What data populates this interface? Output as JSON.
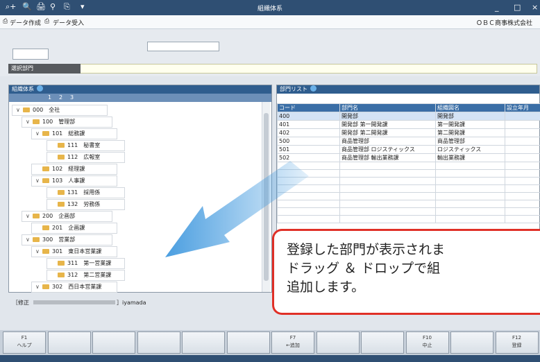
{
  "window": {
    "title": "組織体系"
  },
  "titlebar": {
    "icons": [
      "⌕+",
      "🔍",
      "🖨",
      "⚲",
      "⎘",
      "▾"
    ],
    "controls": [
      "_",
      "□",
      "×"
    ]
  },
  "menubar": {
    "create": "データ作成",
    "import": "データ受入",
    "company": "ＯＢＣ商事株式会社"
  },
  "selection": {
    "label": "選択部門"
  },
  "tree": {
    "title": "組織体系",
    "levels": [
      "1",
      "2",
      "3"
    ],
    "rows": [
      {
        "text": "000　全社",
        "chev": "∨"
      },
      {
        "text": "100　管理部",
        "chev": "∨"
      },
      {
        "text": "101　総務課",
        "chev": "∨"
      },
      {
        "text": "111　秘書室",
        "chev": ""
      },
      {
        "text": "112　広報室",
        "chev": ""
      },
      {
        "text": "102　経理課",
        "chev": ""
      },
      {
        "text": "103　人事課",
        "chev": "∨"
      },
      {
        "text": "131　採用係",
        "chev": ""
      },
      {
        "text": "132　労務係",
        "chev": ""
      },
      {
        "text": "200　企画部",
        "chev": "∨"
      },
      {
        "text": "201　企画課",
        "chev": ""
      },
      {
        "text": "300　営業部",
        "chev": "∨"
      },
      {
        "text": "301　東日本営業課",
        "chev": "∨"
      },
      {
        "text": "311　第一営業課",
        "chev": ""
      },
      {
        "text": "312　第二営業課",
        "chev": ""
      },
      {
        "text": "302　西日本営業課",
        "chev": "∨"
      }
    ]
  },
  "list": {
    "title": "部門リスト",
    "headers": [
      "コード",
      "部門名",
      "組織図名",
      "設立年月"
    ],
    "rows": [
      [
        "400",
        "開発部",
        "開発部",
        ""
      ],
      [
        "401",
        "開発部 第一開発課",
        "第一開発課",
        ""
      ],
      [
        "402",
        "開発部 第二開発課",
        "第二開発課",
        ""
      ],
      [
        "500",
        "商品管理部",
        "商品管理部",
        ""
      ],
      [
        "501",
        "商品管理部 ロジスティックス",
        "ロジスティックス",
        ""
      ],
      [
        "502",
        "商品管理部 輸出業務課",
        "輸出業務課",
        ""
      ]
    ]
  },
  "status": {
    "label": "［修正",
    "user": "］iyamada"
  },
  "fkeys": [
    {
      "num": "F1",
      "label": "ヘルプ"
    },
    {
      "num": "",
      "label": ""
    },
    {
      "num": "",
      "label": ""
    },
    {
      "num": "",
      "label": ""
    },
    {
      "num": "",
      "label": ""
    },
    {
      "num": "",
      "label": ""
    },
    {
      "num": "F7",
      "label": "←追加"
    },
    {
      "num": "",
      "label": ""
    },
    {
      "num": "",
      "label": ""
    },
    {
      "num": "F10",
      "label": "中止"
    },
    {
      "num": "",
      "label": ""
    },
    {
      "num": "F12",
      "label": "登録"
    }
  ],
  "callout": {
    "line1": "登録した部門が表示されま",
    "line2": "ドラッグ ＆ ドロップで組",
    "line3": "追加します。"
  },
  "colors": {
    "titlebar": "#2f4f73",
    "callout_border": "#e03027",
    "arrow": "#4a9ee0",
    "folder": "#e7b54a"
  }
}
